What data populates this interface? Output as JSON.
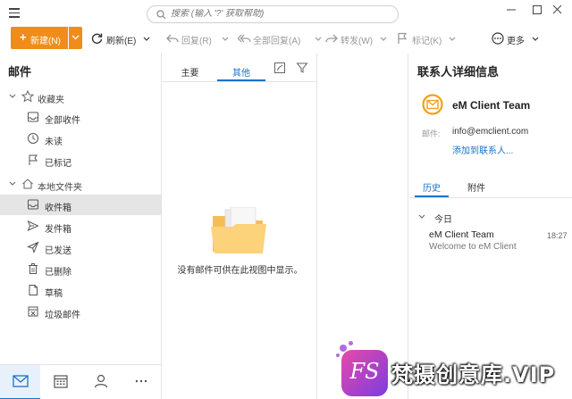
{
  "search": {
    "placeholder": "搜索 (输入 '?' 获取帮助)"
  },
  "toolbar": {
    "new_label": "新建(N)",
    "refresh_label": "刷新(E)",
    "reply_label": "回复(R)",
    "reply_all_label": "全部回复(A)",
    "forward_label": "转发(W)",
    "flag_label": "标记(K)",
    "more_label": "更多"
  },
  "folders": {
    "title": "邮件",
    "favorites": {
      "label": "收藏夹",
      "items": [
        {
          "label": "全部收件",
          "icon": "inbox-icon"
        },
        {
          "label": "未读",
          "icon": "clock-icon"
        },
        {
          "label": "已标记",
          "icon": "flag-icon"
        }
      ]
    },
    "local": {
      "label": "本地文件夹",
      "items": [
        {
          "label": "收件箱",
          "icon": "inbox-icon",
          "selected": true
        },
        {
          "label": "发件箱",
          "icon": "outbox-icon"
        },
        {
          "label": "已发送",
          "icon": "sent-icon"
        },
        {
          "label": "已删除",
          "icon": "trash-icon"
        },
        {
          "label": "草稿",
          "icon": "draft-icon"
        },
        {
          "label": "垃圾邮件",
          "icon": "junk-icon"
        }
      ]
    }
  },
  "bottom_nav": [
    {
      "icon": "mail-icon",
      "selected": true
    },
    {
      "icon": "calendar-icon"
    },
    {
      "icon": "contacts-icon"
    },
    {
      "icon": "more-dots-icon"
    }
  ],
  "message_list": {
    "tab_main": "主要",
    "tab_other": "其他",
    "empty_text": "没有邮件可供在此视图中显示。"
  },
  "contact": {
    "title": "联系人详细信息",
    "name": "eM Client Team",
    "email_label": "邮件:",
    "email": "info@emclient.com",
    "add_link": "添加到联系人...",
    "tab_history": "历史",
    "tab_attachments": "附件",
    "day_group": "今日",
    "history": [
      {
        "from": "eM Client Team",
        "time": "18:27",
        "subject": "Welcome to eM Client"
      }
    ]
  },
  "watermark": {
    "badge": "FS",
    "text": "梵摄创意库.VIP"
  },
  "colors": {
    "accent": "#1a73c9",
    "new_button": "#f08c1a",
    "selection": "#e5e5e5"
  }
}
